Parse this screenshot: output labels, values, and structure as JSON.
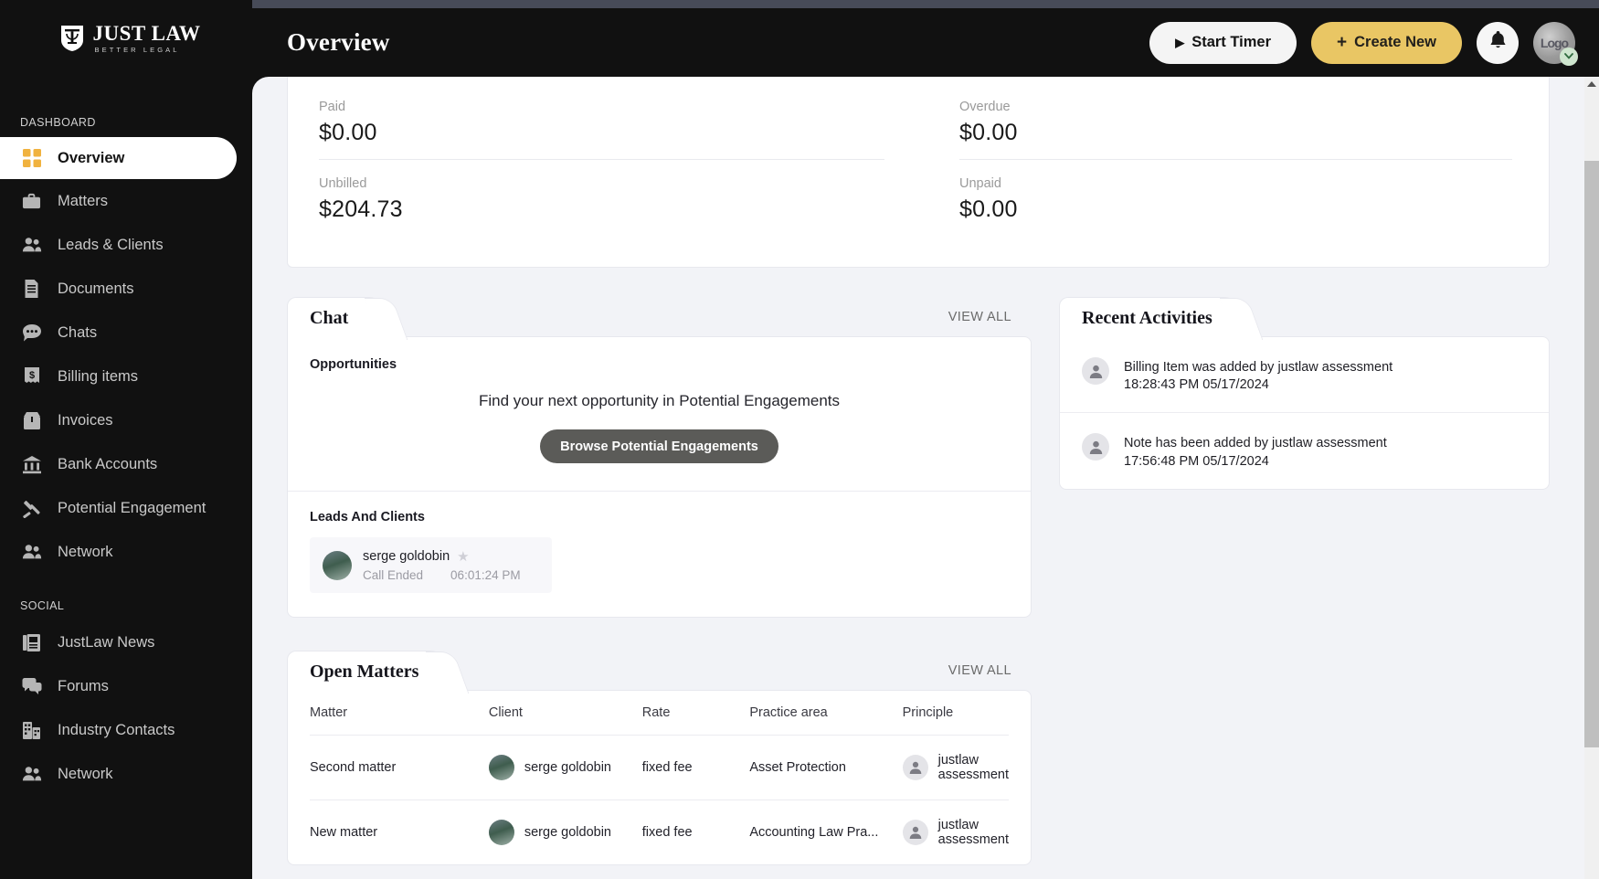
{
  "brand": {
    "name": "JUST LAW",
    "tagline": "BETTER LEGAL",
    "accent": "#e9c664"
  },
  "header": {
    "title": "Overview",
    "start_timer_label": "Start Timer",
    "create_new_label": "Create New",
    "create_new_plus": "+",
    "play_glyph": "▶"
  },
  "sidebar": {
    "sections": [
      {
        "label": "DASHBOARD",
        "items": [
          {
            "label": "Overview",
            "icon": "grid-icon",
            "active": true
          },
          {
            "label": "Matters",
            "icon": "briefcase-icon",
            "active": false
          },
          {
            "label": "Leads & Clients",
            "icon": "people-icon",
            "active": false
          },
          {
            "label": "Documents",
            "icon": "document-icon",
            "active": false
          },
          {
            "label": "Chats",
            "icon": "chat-bubble-icon",
            "active": false
          },
          {
            "label": "Billing items",
            "icon": "receipt-dollar-icon",
            "active": false
          },
          {
            "label": "Invoices",
            "icon": "invoice-icon",
            "active": false
          },
          {
            "label": "Bank Accounts",
            "icon": "bank-icon",
            "active": false
          },
          {
            "label": "Potential Engagement",
            "icon": "gavel-icon",
            "active": false
          },
          {
            "label": "Network",
            "icon": "people-icon",
            "active": false
          }
        ]
      },
      {
        "label": "SOCIAL",
        "items": [
          {
            "label": "JustLaw News",
            "icon": "newspaper-icon",
            "active": false
          },
          {
            "label": "Forums",
            "icon": "forum-icon",
            "active": false
          },
          {
            "label": "Industry Contacts",
            "icon": "building-icon",
            "active": false
          },
          {
            "label": "Network",
            "icon": "people-icon",
            "active": false
          }
        ]
      }
    ]
  },
  "finance": {
    "paid_label": "Paid",
    "paid_value": "$0.00",
    "unbilled_label": "Unbilled",
    "unbilled_value": "$204.73",
    "overdue_label": "Overdue",
    "overdue_value": "$0.00",
    "unpaid_label": "Unpaid",
    "unpaid_value": "$0.00"
  },
  "chat_card": {
    "tab_title": "Chat",
    "view_all": "VIEW ALL",
    "opportunities_label": "Opportunities",
    "opportunity_message": "Find your next opportunity in Potential Engagements",
    "browse_button": "Browse Potential Engagements",
    "leads_label": "Leads And Clients",
    "lead": {
      "name": "serge goldobin",
      "star": "★",
      "status": "Call Ended",
      "time": "06:01:24 PM"
    }
  },
  "activities_card": {
    "tab_title": "Recent Activities",
    "items": [
      {
        "text": "Billing Item was added by justlaw assessment",
        "time": "18:28:43 PM 05/17/2024"
      },
      {
        "text": "Note has been added by justlaw assessment",
        "time": "17:56:48 PM 05/17/2024"
      }
    ]
  },
  "matters_card": {
    "tab_title": "Open Matters",
    "view_all": "VIEW ALL",
    "columns": [
      "Matter",
      "Client",
      "Rate",
      "Practice area",
      "Principle"
    ],
    "rows": [
      {
        "matter": "Second matter",
        "client": "serge goldobin",
        "rate": "fixed fee",
        "practice_area": "Asset Protection",
        "principle": "justlaw assessment"
      },
      {
        "matter": "New matter",
        "client": "serge goldobin",
        "rate": "fixed fee",
        "practice_area": "Accounting Law Pra...",
        "principle": "justlaw assessment"
      }
    ]
  }
}
